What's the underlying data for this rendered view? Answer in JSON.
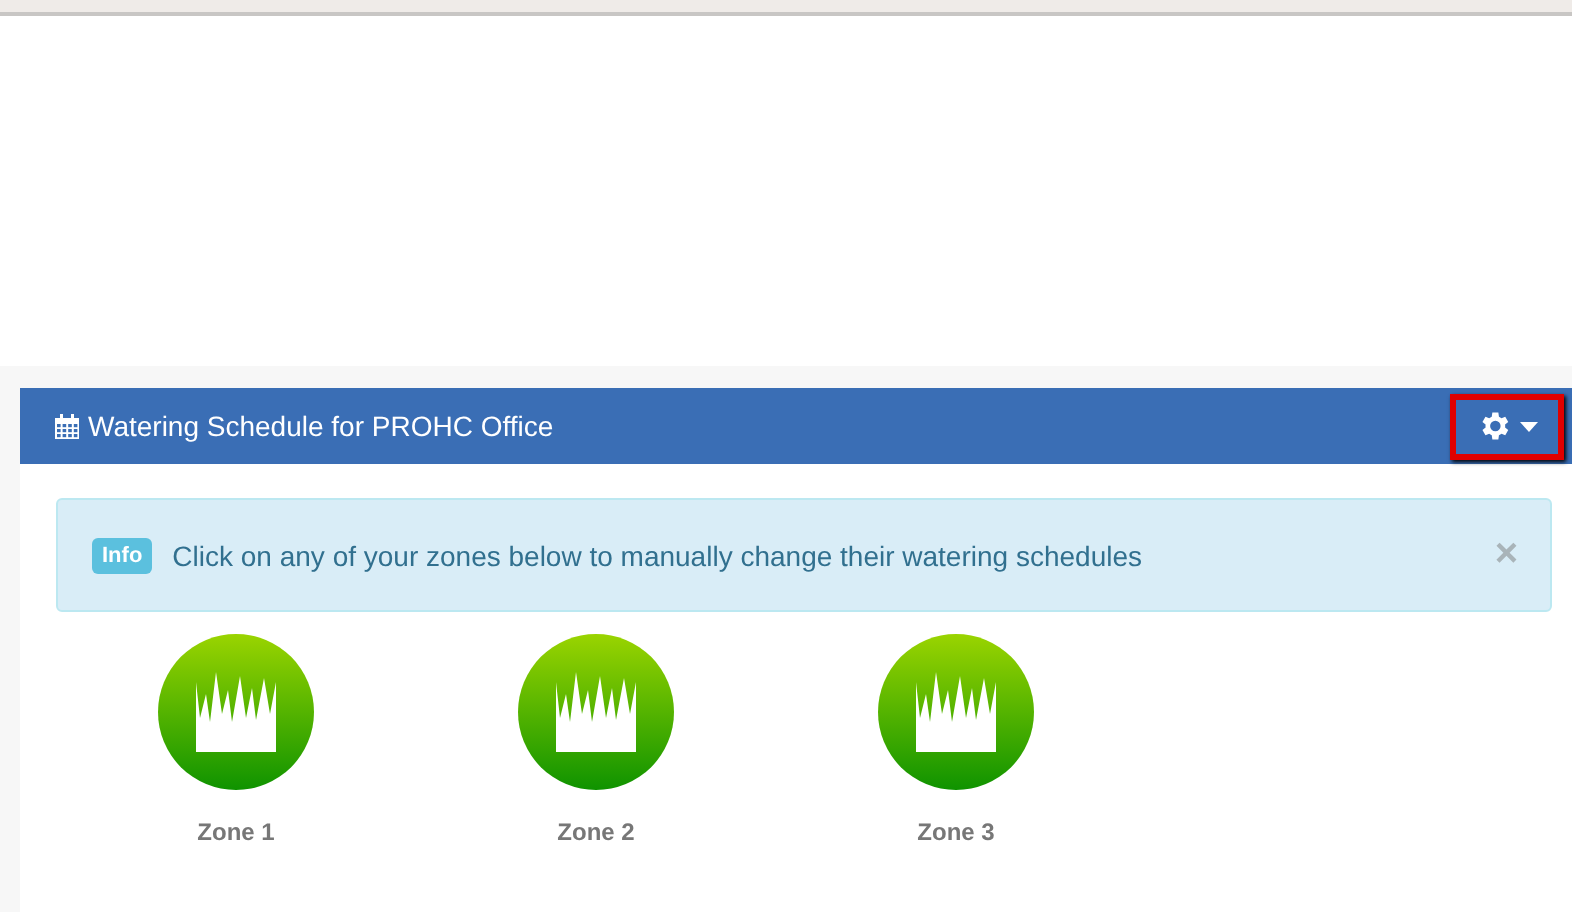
{
  "panel": {
    "title": "Watering Schedule for PROHC Office"
  },
  "alert": {
    "badge": "Info",
    "message": "Click on any of your zones below to manually change their watering schedules",
    "close": "×"
  },
  "zones": [
    {
      "name": "Zone 1"
    },
    {
      "name": "Zone 2"
    },
    {
      "name": "Zone 3"
    }
  ]
}
